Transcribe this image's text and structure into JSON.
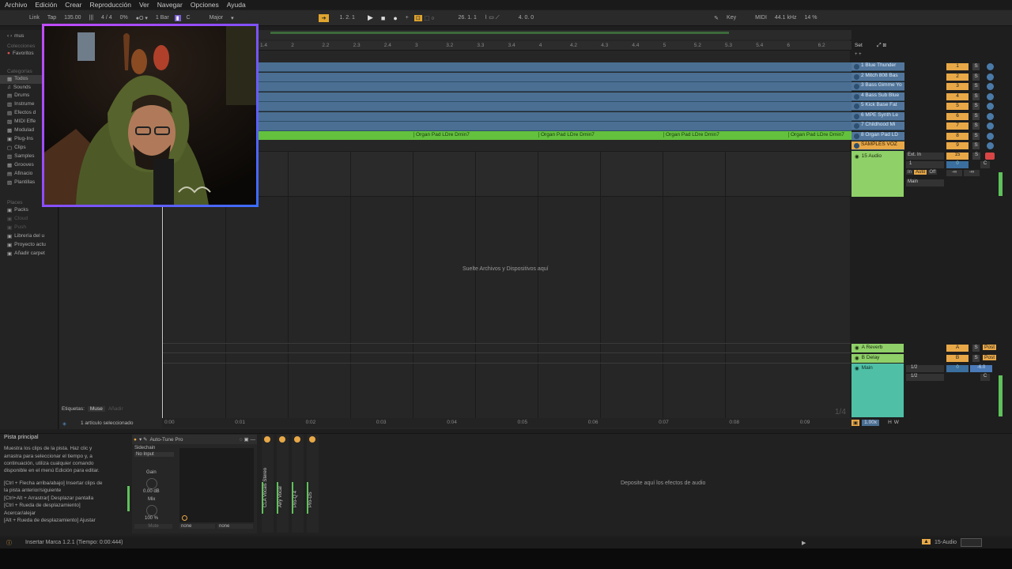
{
  "menu": [
    "Archivo",
    "Edición",
    "Crear",
    "Reproducción",
    "Ver",
    "Navegar",
    "Opciones",
    "Ayuda"
  ],
  "transport": {
    "link": "Link",
    "tap": "Tap",
    "tempo": "135.00",
    "sig": "4 / 4",
    "pct": "0%",
    "quant": "1 Bar",
    "key": "C",
    "scale": "Major",
    "position": "1. 2. 1",
    "loop_start": "26. 1. 1",
    "loop_len": "4. 0. 0",
    "key_label": "Key",
    "midi_label": "MIDI",
    "samplerate": "44.1 kHz",
    "cpu": "14 %"
  },
  "browser": {
    "search_label": "mus",
    "collections_title": "Colecciones",
    "favoritos": "Favoritos",
    "categorias_title": "Categorías",
    "categories": [
      "Todos",
      "Sounds",
      "Drums",
      "Instrume",
      "Efectos d",
      "MIDI Effe",
      "Modulad",
      "Plug-Ins",
      "Clips",
      "Samples",
      "Grooves",
      "Afinacio",
      "Plantillas"
    ],
    "places_title": "Places",
    "places": [
      "Packs",
      "Cloud",
      "Push",
      "Librería del u",
      "Proyecto actu",
      "Añadir carpet"
    ],
    "tags_label": "Etiquetas:",
    "tag_value": "Muse",
    "tag_add": "Añadir",
    "selected_info": "1 artículo seleccionado"
  },
  "ruler_ticks": [
    "1.4",
    "2",
    "2.2",
    "2.3",
    "2.4",
    "3",
    "3.2",
    "3.3",
    "3.4",
    "4",
    "4.2",
    "4.3",
    "4.4",
    "5",
    "5.2",
    "5.3",
    "5.4",
    "6",
    "6.2"
  ],
  "ruler_ticks_display": [
    "1.4",
    "2",
    "2.2",
    "2.3",
    "2.4",
    "3",
    "3.2",
    "3.3",
    "3.4",
    "4",
    "4.2",
    "4.3",
    "4.4",
    "5",
    "5.2",
    "5.3",
    "5.4",
    "6",
    "6.2"
  ],
  "set_label": "Set",
  "tracks": [
    {
      "name": "1 Blue Thunder",
      "num": "1"
    },
    {
      "name": "2 Mitch 808 Bas",
      "num": "2"
    },
    {
      "name": "3 Bass Gimme Yo",
      "num": "3"
    },
    {
      "name": "4 Bass Sub Blue",
      "num": "4"
    },
    {
      "name": "5 Kick Base Fat",
      "num": "5"
    },
    {
      "name": "6 MPE Synth Le",
      "num": "6"
    },
    {
      "name": "7 Childhood Mi",
      "num": "7"
    },
    {
      "name": "8 Organ Pad LD",
      "num": "8"
    },
    {
      "name": "SAMPLES VOZ",
      "num": "9"
    },
    {
      "name": "15 Audio",
      "num": "15"
    }
  ],
  "organ_clips": [
    "Organ Pad LDre Dmin7",
    "Organ Pad LDre Dmin7",
    "Organ Pad LDre Dmin7",
    "Organ Pad LDre Dmin7"
  ],
  "io": {
    "input": "Ext. In",
    "channel": "1",
    "monitor_in": "In",
    "monitor_auto": "Auto",
    "monitor_off": "Off",
    "output": "Main",
    "inf": "-∞",
    "pan": "C",
    "vol": "0"
  },
  "drop_zone": "Suelte Archivos y Dispositivos aquí",
  "returns": [
    {
      "name": "A Reverb",
      "letter": "A",
      "send": "Post"
    },
    {
      "name": "B Delay",
      "letter": "B",
      "send": "Post"
    }
  ],
  "main_track": {
    "name": "Main",
    "out1": "1/2",
    "out2": "1/2",
    "vol": "0",
    "db": "-6.0",
    "pan": "C"
  },
  "page_indicator": "1/4",
  "time_ticks": [
    "0:00",
    "0:01",
    "0:02",
    "0:03",
    "0:04",
    "0:05",
    "0:06",
    "0:07",
    "0:08",
    "0:09"
  ],
  "zoom": "1.00x",
  "hw": [
    "H",
    "W"
  ],
  "info": {
    "title": "Pista principal",
    "body": [
      "Muestra los clips de la pista. Haz clic y",
      "arrastra para seleccionar el tiempo y, a",
      "continuación, utiliza cualquier comando",
      "disponible en el menú Edición para editar.",
      "",
      "[Ctrl + Flecha arriba/abajo] Insertar clips de",
      "la pista anterior/siguiente",
      "[Ctrl+Alt + Arrastrar] Desplazar pantalla",
      "[Ctrl + Rueda de desplazamiento]",
      "Acercar/alejar",
      "[Alt + Rueda de desplazamiento] Ajustar"
    ]
  },
  "device": {
    "name": "Auto-Tune Pro",
    "sidechain": "Sidechain",
    "no_input": "No Input",
    "gain": "Gain",
    "gain_val": "0.00 dB",
    "mix": "Mix",
    "mix_val": "100 %",
    "mute": "Mute",
    "none1": "none",
    "none2": "none"
  },
  "plugins": [
    "CLA Vocals Stereo",
    "Airy Vocal",
    "Pro-Q 4",
    "Pro-DS"
  ],
  "fx_drop": "Deposite aquí los efectos de audio",
  "status": {
    "text": "Insertar Marca 1.2.1 (Tiempo: 0:00:444)",
    "track": "15-Audio"
  },
  "colors": {
    "lane_blue": "#4a6f92",
    "green": "#63c13d",
    "orange": "#e8a847",
    "teal": "#4fbfa6",
    "return_green": "#8fd068"
  }
}
